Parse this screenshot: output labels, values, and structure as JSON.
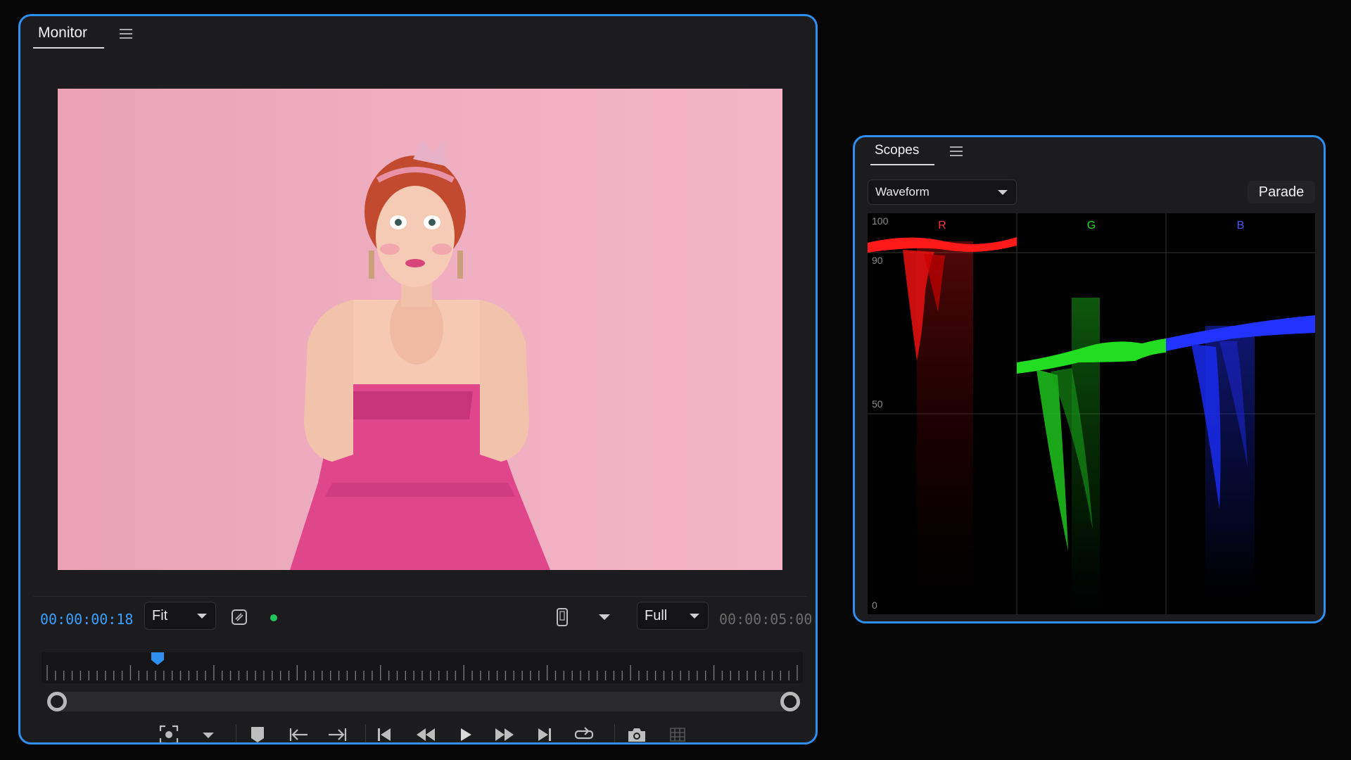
{
  "monitor": {
    "tab_title": "Monitor",
    "current_timecode": "00:00:00:18",
    "duration_timecode": "00:00:05:00",
    "zoom_select": "Fit",
    "resolution_select": "Full",
    "playhead_position": 0.15,
    "status_color": "#22c55e",
    "icons": [
      "menu-icon",
      "safe-margins-icon",
      "device-icon",
      "chevron-down-icon",
      "target-icon",
      "marker-icon",
      "go-to-in-icon",
      "go-to-out-icon",
      "step-back-icon",
      "rewind-icon",
      "play-icon",
      "fast-forward-icon",
      "step-forward-icon",
      "loop-icon",
      "camera-icon",
      "grid-icon"
    ]
  },
  "scopes": {
    "tab_title": "Scopes",
    "scope_type": "Waveform",
    "mode_button": "Parade",
    "channels": [
      {
        "label": "R",
        "color": "#ff1a1a"
      },
      {
        "label": "G",
        "color": "#22dd22"
      },
      {
        "label": "B",
        "color": "#2233ff"
      }
    ],
    "scale_labels": [
      "100",
      "90",
      "50",
      "0"
    ]
  },
  "colors": {
    "accent": "#2e8ff0",
    "timecode": "#3aa0ff",
    "panel_bg": "#1c1c1e",
    "frame_background": "#efadc0"
  }
}
